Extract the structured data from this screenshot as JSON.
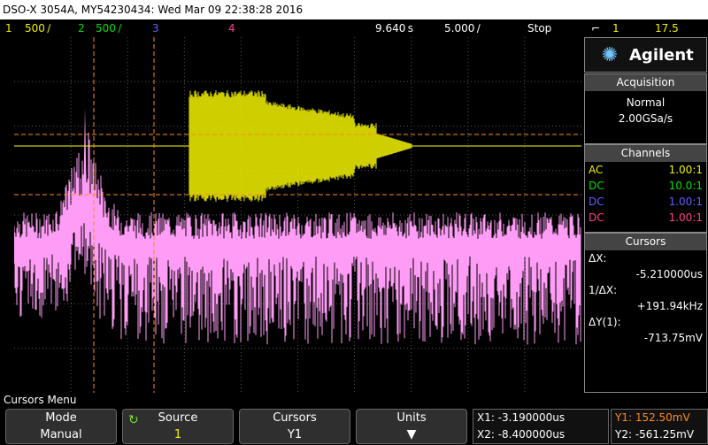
{
  "title": "DSO-X 3054A, MY54230434: Wed Mar 09 22:38:28 2016",
  "channels_bar": {
    "ch1": "1",
    "ch1_scale": "500 ∕",
    "ch2": "2",
    "ch2_scale": "500 ∕",
    "ch3": "3",
    "ch4": "4",
    "delay": "9.640 s",
    "timebase": "5.000 ∕",
    "run_state": "Stop",
    "trig_source": "1",
    "trig_level": "17.5 "
  },
  "brand": "Agilent",
  "acquisition": {
    "header": "Acquisition",
    "mode": "Normal",
    "rate": "2.00GSa/s"
  },
  "channels": {
    "header": "Channels",
    "rows": [
      {
        "coupling": "AC",
        "probe": "1.00:1",
        "color": "#f2f200"
      },
      {
        "coupling": "DC",
        "probe": "10.0:1",
        "color": "#00e000"
      },
      {
        "coupling": "DC",
        "probe": "1.00:1",
        "color": "#5f5fff"
      },
      {
        "coupling": "DC",
        "probe": "1.00:1",
        "color": "#ff3f8f"
      }
    ]
  },
  "cursors": {
    "header": "Cursors",
    "dx_label": "ΔX:",
    "dx_value": "-5.210000us",
    "inv_dx_label": "1/ΔX:",
    "inv_dx_value": "+191.94kHz",
    "dy_label": "ΔY(1):",
    "dy_value": "-713.75mV"
  },
  "menu_title": "Cursors Menu",
  "softkeys": [
    {
      "label": "Mode",
      "value": "Manual"
    },
    {
      "label": "Source",
      "value": "1"
    },
    {
      "label": "Cursors",
      "value": "Y1"
    },
    {
      "label": "Units",
      "value": ""
    }
  ],
  "readouts": {
    "x1": "X1: -3.190000us",
    "x2": "X2: -8.400000us",
    "y1": "Y1: 152.50mV",
    "y2": "Y2: -561.25mV"
  },
  "colors": {
    "ch1": "#f2f200",
    "ch2": "#00e000",
    "ch3": "#5f5fff",
    "ch4": "#ff3f8f",
    "math": "#ff9cf6",
    "cursor": "#ff8c1a"
  }
}
